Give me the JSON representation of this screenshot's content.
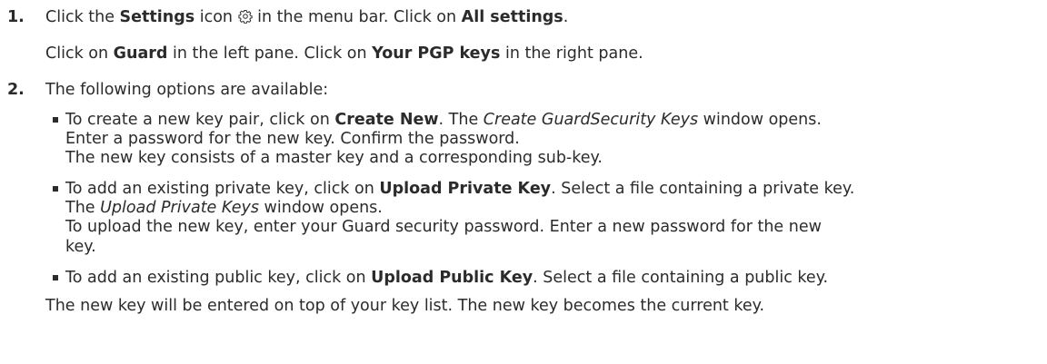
{
  "step1": {
    "number": "1.",
    "line1": {
      "t1": "Click the ",
      "b1": "Settings",
      "t2": " icon ",
      "t3": " in the menu bar. Click on ",
      "b2": "All settings",
      "t4": "."
    },
    "line2": {
      "t1": "Click on ",
      "b1": "Guard",
      "t2": " in the left pane. Click on ",
      "b2": "Your PGP keys",
      "t3": " in the right pane."
    }
  },
  "step2": {
    "number": "2.",
    "intro": "The following options are available:",
    "bullet1": {
      "line1": {
        "t1": "To create a new key pair, click on ",
        "b1": "Create New",
        "t2": ". The ",
        "i1": "Create GuardSecurity Keys",
        "t3": " window opens."
      },
      "line2": "Enter a password for the new key. Confirm the password.",
      "line3": "The new key consists of a master key and a corresponding sub-key."
    },
    "bullet2": {
      "line1": {
        "t1": "To add an existing private key, click on ",
        "b1": "Upload Private Key",
        "t2": ". Select a file containing a private key."
      },
      "line2": {
        "t1": "The ",
        "i1": "Upload Private Keys",
        "t2": " window opens."
      },
      "line3": "To upload the new key, enter your Guard security password. Enter a new password for the new",
      "line4": "key."
    },
    "bullet3": {
      "line1": {
        "t1": "To add an existing public key, click on ",
        "b1": "Upload Public Key",
        "t2": ". Select a file containing a public key."
      }
    },
    "closing": "The new key will be entered on top of your key list. The new key becomes the current key."
  },
  "icons": {
    "settings": "gear-icon"
  }
}
